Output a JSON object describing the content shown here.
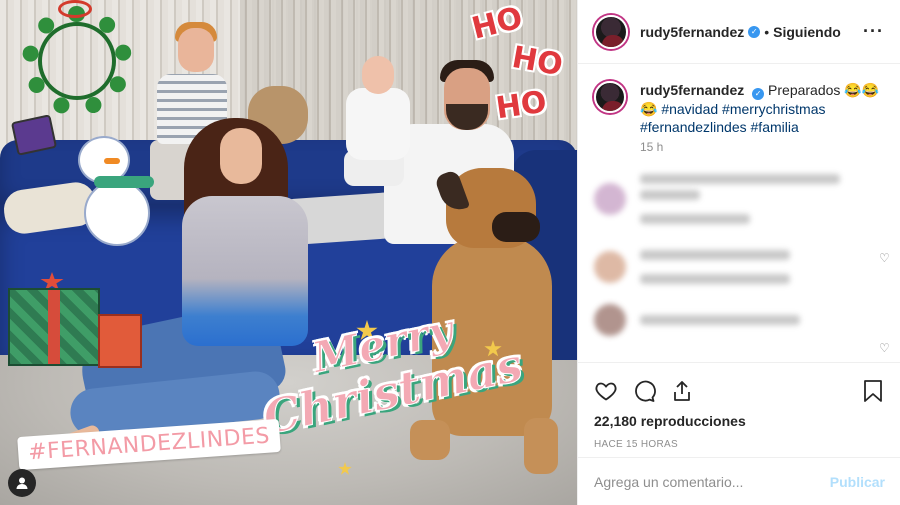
{
  "post": {
    "author": "rudy5fernandez",
    "follow_status": "Siguiendo",
    "more_icon": "more-icon",
    "verified_icon": "verified-icon"
  },
  "caption": {
    "username": "rudy5fernandez",
    "text": "Preparados 😂😂😂",
    "hashtags": "#navidad #merrychristmas #fernandezlindes #familia",
    "time": "15 h"
  },
  "media": {
    "sticker_hohoho": [
      "HO",
      "HO",
      "HO"
    ],
    "sticker_merry": "Merry",
    "sticker_christmas": "Christmas",
    "sticker_hashtag": "#FERNANDEZLINDES"
  },
  "actions": {
    "icons": [
      "heart-icon",
      "comment-icon",
      "share-icon",
      "bookmark-icon"
    ],
    "views": "22,180 reproducciones",
    "posted_ago": "HACE 15 HORAS"
  },
  "comment_box": {
    "placeholder": "Agrega un comentario...",
    "publish_label": "Publicar"
  },
  "colors": {
    "link": "#00376b",
    "muted": "#8e8e8e",
    "publish_disabled": "#b2dffc",
    "verified": "#3897f0"
  }
}
